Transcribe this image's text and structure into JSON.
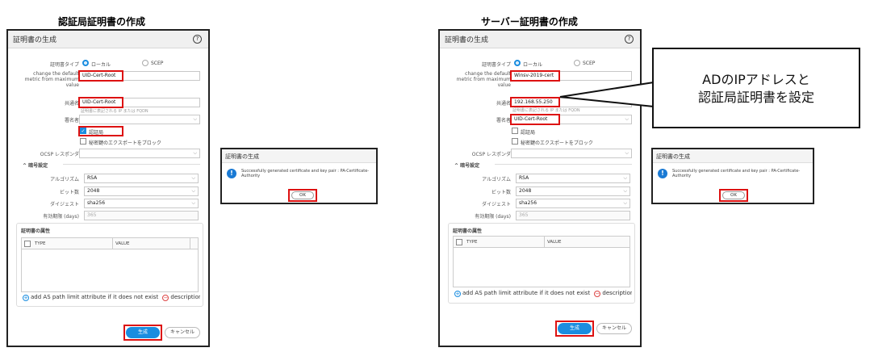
{
  "headings": {
    "left": "認証局証明書の作成",
    "right": "サーバー証明書の作成"
  },
  "dialog": {
    "title": "証明書の生成",
    "help_icon": "?",
    "type_label": "証明書タイプ",
    "type_local": "ローカル",
    "type_scep": "SCEP",
    "cn_label_lines": [
      "change the default",
      "metric from maximum",
      "value"
    ],
    "common_name_label": "共通名",
    "common_name_hint": "証明書に表記される IP または FQDN",
    "signed_by_label": "署名者",
    "ca_label": "認証局",
    "block_export_label": "秘密鍵のエクスポートをブロック",
    "ocsp_label": "OCSP レスポンダ",
    "crypto_section": "暗号設定",
    "algorithm_label": "アルゴリズム",
    "algorithm_value": "RSA",
    "bits_label": "ビット数",
    "bits_value": "2048",
    "digest_label": "ダイジェスト",
    "digest_value": "sha256",
    "expiry_label": "有効期限 (days)",
    "expiry_value": "365",
    "attr_section": "証明書の属性",
    "col_type": "TYPE",
    "col_value": "VALUE",
    "add_link": "add AS path limit attribute if it does not exist",
    "delete_link": "description c",
    "generate": "生成",
    "cancel": "キャンセル"
  },
  "left_form": {
    "cert_name": "UID-Cert-Root",
    "common_name": "UID-Cert-Root"
  },
  "right_form": {
    "cert_name": "Winsv-2019-cert",
    "common_name": "192.168.55.250",
    "signed_by": "UID-Cert-Root"
  },
  "success": {
    "title": "証明書の生成",
    "message": "Successfully generated certificate and key pair : PA-Certificate-Authority",
    "ok": "OK"
  },
  "callout": {
    "line1": "ADのIPアドレスと",
    "line2": "認証局証明書を設定"
  },
  "colors": {
    "accent": "#1a8de0",
    "highlight": "#dd1111"
  }
}
